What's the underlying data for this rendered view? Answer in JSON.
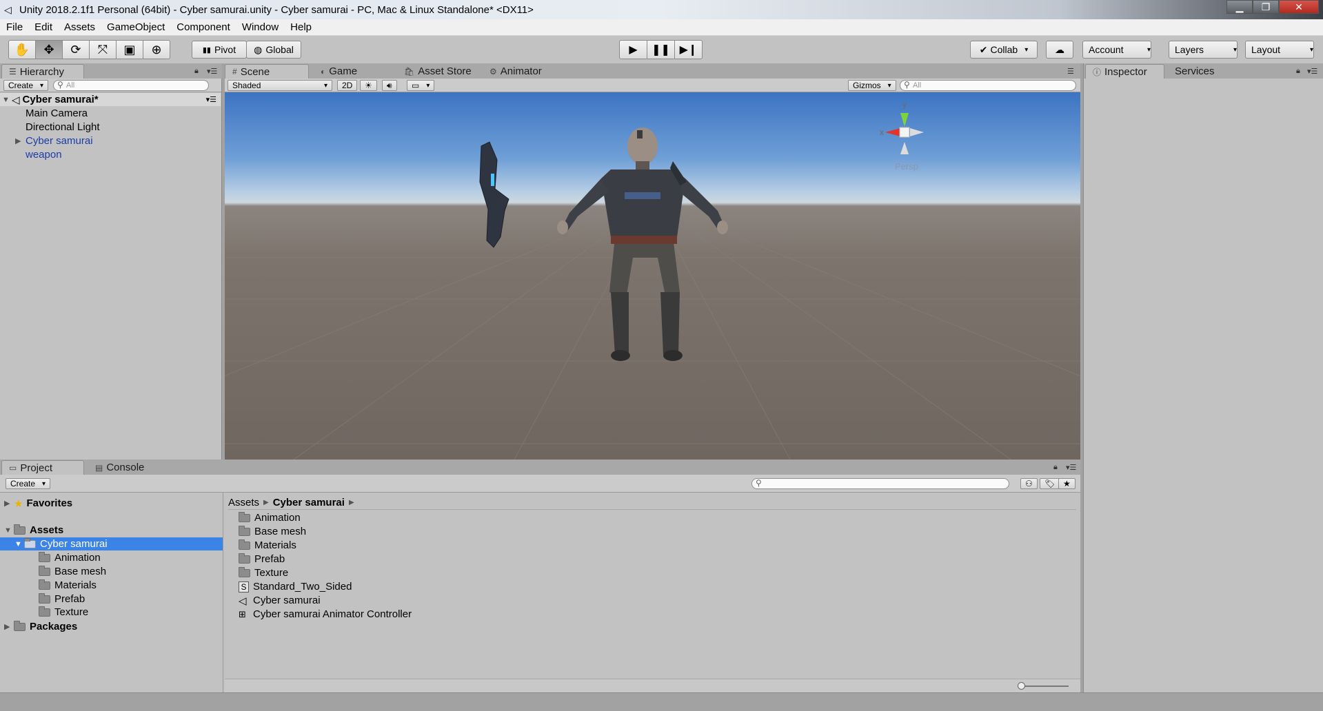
{
  "window": {
    "title": "Unity 2018.2.1f1 Personal (64bit) - Cyber samurai.unity - Cyber samurai - PC, Mac & Linux Standalone* <DX11>"
  },
  "menu": [
    "File",
    "Edit",
    "Assets",
    "GameObject",
    "Component",
    "Window",
    "Help"
  ],
  "toolbar": {
    "pivot": "Pivot",
    "global": "Global",
    "collab": "Collab",
    "account": "Account",
    "layers": "Layers",
    "layout": "Layout"
  },
  "hierarchy": {
    "tab": "Hierarchy",
    "create": "Create",
    "search_placeholder": "All",
    "scene_name": "Cyber samurai*",
    "items": [
      "Main Camera",
      "Directional Light",
      "Cyber samurai",
      "weapon"
    ]
  },
  "scene": {
    "tabs": [
      "Scene",
      "Game",
      "Asset Store",
      "Animator"
    ],
    "shading": "Shaded",
    "mode_2d": "2D",
    "gizmos": "Gizmos",
    "search_placeholder": "All",
    "gizmo": {
      "y": "y",
      "x": "x",
      "persp": "Persp"
    }
  },
  "inspector": {
    "tabs": [
      "Inspector",
      "Services"
    ]
  },
  "project": {
    "tabs": [
      "Project",
      "Console"
    ],
    "create": "Create",
    "tree": {
      "favorites": "Favorites",
      "assets": "Assets",
      "selected": "Cyber samurai",
      "children": [
        "Animation",
        "Base mesh",
        "Materials",
        "Prefab",
        "Texture"
      ],
      "packages": "Packages"
    },
    "breadcrumb": [
      "Assets",
      "Cyber samurai"
    ],
    "files": [
      {
        "name": "Animation",
        "icon": "folder-icon"
      },
      {
        "name": "Base mesh",
        "icon": "folder-icon"
      },
      {
        "name": "Materials",
        "icon": "folder-icon"
      },
      {
        "name": "Prefab",
        "icon": "folder-icon"
      },
      {
        "name": "Texture",
        "icon": "folder-icon"
      },
      {
        "name": "Standard_Two_Sided",
        "icon": "shader-icon"
      },
      {
        "name": "Cyber samurai",
        "icon": "unity-scene-icon"
      },
      {
        "name": "Cyber samurai Animator Controller",
        "icon": "animator-controller-icon"
      }
    ]
  },
  "colors": {
    "selection": "#3b83e6",
    "panel": "#c2c2c2",
    "link_blue": "#1a3ca8"
  }
}
